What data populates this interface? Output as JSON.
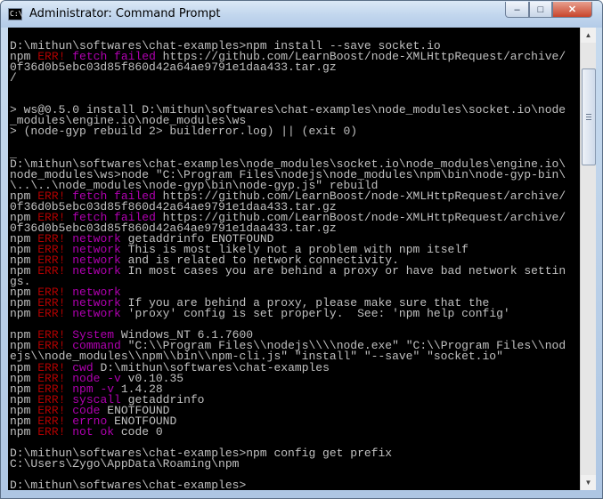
{
  "window": {
    "title": "Administrator: Command Prompt",
    "icon_text": "C:\\",
    "icon": "console-icon"
  },
  "controls": {
    "minimize_icon": "minimize-icon",
    "maximize_icon": "maximize-icon",
    "close_icon": "close-icon",
    "minimize_glyph": "–",
    "maximize_glyph": "□",
    "close_glyph": "✕"
  },
  "scrollbar": {
    "up_glyph": "▲",
    "down_glyph": "▼",
    "thumb_fraction_top": 0.06,
    "thumb_fraction_size": 0.22
  },
  "colors": {
    "console_bg": "#000000",
    "console_text": "#c0c0c0",
    "err_red": "#b00000",
    "err_magenta": "#b000b0"
  },
  "console_lines": [
    [
      {
        "t": "D:\\mithun\\softwares\\chat-examples>npm install --save socket.io",
        "c": "gray"
      }
    ],
    [
      {
        "t": "npm ",
        "c": "gray"
      },
      {
        "t": "ERR!",
        "c": "red"
      },
      {
        "t": " ",
        "c": "gray"
      },
      {
        "t": "fetch failed",
        "c": "mag"
      },
      {
        "t": " https://github.com/LearnBoost/node-XMLHttpRequest/archive/",
        "c": "gray"
      }
    ],
    [
      {
        "t": "0f36d0b5ebc03d85f860d42a64ae9791e1daa433.tar.gz",
        "c": "gray"
      }
    ],
    [
      {
        "t": "/",
        "c": "gray"
      }
    ],
    [
      {
        "t": "",
        "c": "gray"
      }
    ],
    [
      {
        "t": "",
        "c": "gray"
      }
    ],
    [
      {
        "t": "> ws@0.5.0 install D:\\mithun\\softwares\\chat-examples\\node_modules\\socket.io\\node",
        "c": "gray"
      }
    ],
    [
      {
        "t": "_modules\\engine.io\\node_modules\\ws",
        "c": "gray"
      }
    ],
    [
      {
        "t": "> (node-gyp rebuild 2> builderror.log) || (exit 0)",
        "c": "gray"
      }
    ],
    [
      {
        "t": "",
        "c": "gray"
      }
    ],
    [
      {
        "t": "_",
        "c": "gray"
      }
    ],
    [
      {
        "t": "D:\\mithun\\softwares\\chat-examples\\node_modules\\socket.io\\node_modules\\engine.io\\",
        "c": "gray"
      }
    ],
    [
      {
        "t": "node_modules\\ws>node \"C:\\Program Files\\nodejs\\node_modules\\npm\\bin\\node-gyp-bin\\",
        "c": "gray"
      }
    ],
    [
      {
        "t": "\\..\\..\\node_modules\\node-gyp\\bin\\node-gyp.js\" rebuild",
        "c": "gray"
      }
    ],
    [
      {
        "t": "npm ",
        "c": "gray"
      },
      {
        "t": "ERR!",
        "c": "red"
      },
      {
        "t": " ",
        "c": "gray"
      },
      {
        "t": "fetch failed",
        "c": "mag"
      },
      {
        "t": " https://github.com/LearnBoost/node-XMLHttpRequest/archive/",
        "c": "gray"
      }
    ],
    [
      {
        "t": "0f36d0b5ebc03d85f860d42a64ae9791e1daa433.tar.gz",
        "c": "gray"
      }
    ],
    [
      {
        "t": "npm ",
        "c": "gray"
      },
      {
        "t": "ERR!",
        "c": "red"
      },
      {
        "t": " ",
        "c": "gray"
      },
      {
        "t": "fetch failed",
        "c": "mag"
      },
      {
        "t": " https://github.com/LearnBoost/node-XMLHttpRequest/archive/",
        "c": "gray"
      }
    ],
    [
      {
        "t": "0f36d0b5ebc03d85f860d42a64ae9791e1daa433.tar.gz",
        "c": "gray"
      }
    ],
    [
      {
        "t": "npm ",
        "c": "gray"
      },
      {
        "t": "ERR!",
        "c": "red"
      },
      {
        "t": " ",
        "c": "gray"
      },
      {
        "t": "network",
        "c": "mag"
      },
      {
        "t": " getaddrinfo ENOTFOUND",
        "c": "gray"
      }
    ],
    [
      {
        "t": "npm ",
        "c": "gray"
      },
      {
        "t": "ERR!",
        "c": "red"
      },
      {
        "t": " ",
        "c": "gray"
      },
      {
        "t": "network",
        "c": "mag"
      },
      {
        "t": " This is most likely not a problem with npm itself",
        "c": "gray"
      }
    ],
    [
      {
        "t": "npm ",
        "c": "gray"
      },
      {
        "t": "ERR!",
        "c": "red"
      },
      {
        "t": " ",
        "c": "gray"
      },
      {
        "t": "network",
        "c": "mag"
      },
      {
        "t": " and is related to network connectivity.",
        "c": "gray"
      }
    ],
    [
      {
        "t": "npm ",
        "c": "gray"
      },
      {
        "t": "ERR!",
        "c": "red"
      },
      {
        "t": " ",
        "c": "gray"
      },
      {
        "t": "network",
        "c": "mag"
      },
      {
        "t": " In most cases you are behind a proxy or have bad network settin",
        "c": "gray"
      }
    ],
    [
      {
        "t": "gs.",
        "c": "gray"
      }
    ],
    [
      {
        "t": "npm ",
        "c": "gray"
      },
      {
        "t": "ERR!",
        "c": "red"
      },
      {
        "t": " ",
        "c": "gray"
      },
      {
        "t": "network",
        "c": "mag"
      }
    ],
    [
      {
        "t": "npm ",
        "c": "gray"
      },
      {
        "t": "ERR!",
        "c": "red"
      },
      {
        "t": " ",
        "c": "gray"
      },
      {
        "t": "network",
        "c": "mag"
      },
      {
        "t": " If you are behind a proxy, please make sure that the",
        "c": "gray"
      }
    ],
    [
      {
        "t": "npm ",
        "c": "gray"
      },
      {
        "t": "ERR!",
        "c": "red"
      },
      {
        "t": " ",
        "c": "gray"
      },
      {
        "t": "network",
        "c": "mag"
      },
      {
        "t": " 'proxy' config is set properly.  See: 'npm help config'",
        "c": "gray"
      }
    ],
    [
      {
        "t": "",
        "c": "gray"
      }
    ],
    [
      {
        "t": "npm ",
        "c": "gray"
      },
      {
        "t": "ERR!",
        "c": "red"
      },
      {
        "t": " ",
        "c": "gray"
      },
      {
        "t": "System",
        "c": "mag"
      },
      {
        "t": " Windows_NT 6.1.7600",
        "c": "gray"
      }
    ],
    [
      {
        "t": "npm ",
        "c": "gray"
      },
      {
        "t": "ERR!",
        "c": "red"
      },
      {
        "t": " ",
        "c": "gray"
      },
      {
        "t": "command",
        "c": "mag"
      },
      {
        "t": " \"C:\\\\Program Files\\\\nodejs\\\\\\\\node.exe\" \"C:\\\\Program Files\\\\nod",
        "c": "gray"
      }
    ],
    [
      {
        "t": "ejs\\\\node_modules\\\\npm\\\\bin\\\\npm-cli.js\" \"install\" \"--save\" \"socket.io\"",
        "c": "gray"
      }
    ],
    [
      {
        "t": "npm ",
        "c": "gray"
      },
      {
        "t": "ERR!",
        "c": "red"
      },
      {
        "t": " ",
        "c": "gray"
      },
      {
        "t": "cwd",
        "c": "mag"
      },
      {
        "t": " D:\\mithun\\softwares\\chat-examples",
        "c": "gray"
      }
    ],
    [
      {
        "t": "npm ",
        "c": "gray"
      },
      {
        "t": "ERR!",
        "c": "red"
      },
      {
        "t": " ",
        "c": "gray"
      },
      {
        "t": "node -v",
        "c": "mag"
      },
      {
        "t": " v0.10.35",
        "c": "gray"
      }
    ],
    [
      {
        "t": "npm ",
        "c": "gray"
      },
      {
        "t": "ERR!",
        "c": "red"
      },
      {
        "t": " ",
        "c": "gray"
      },
      {
        "t": "npm -v",
        "c": "mag"
      },
      {
        "t": " 1.4.28",
        "c": "gray"
      }
    ],
    [
      {
        "t": "npm ",
        "c": "gray"
      },
      {
        "t": "ERR!",
        "c": "red"
      },
      {
        "t": " ",
        "c": "gray"
      },
      {
        "t": "syscall",
        "c": "mag"
      },
      {
        "t": " getaddrinfo",
        "c": "gray"
      }
    ],
    [
      {
        "t": "npm ",
        "c": "gray"
      },
      {
        "t": "ERR!",
        "c": "red"
      },
      {
        "t": " ",
        "c": "gray"
      },
      {
        "t": "code",
        "c": "mag"
      },
      {
        "t": " ENOTFOUND",
        "c": "gray"
      }
    ],
    [
      {
        "t": "npm ",
        "c": "gray"
      },
      {
        "t": "ERR!",
        "c": "red"
      },
      {
        "t": " ",
        "c": "gray"
      },
      {
        "t": "errno",
        "c": "mag"
      },
      {
        "t": " ENOTFOUND",
        "c": "gray"
      }
    ],
    [
      {
        "t": "npm ",
        "c": "gray"
      },
      {
        "t": "ERR!",
        "c": "red"
      },
      {
        "t": " ",
        "c": "gray"
      },
      {
        "t": "not ok",
        "c": "mag"
      },
      {
        "t": " code 0",
        "c": "gray"
      }
    ],
    [
      {
        "t": "",
        "c": "gray"
      }
    ],
    [
      {
        "t": "D:\\mithun\\softwares\\chat-examples>npm config get prefix",
        "c": "gray"
      }
    ],
    [
      {
        "t": "C:\\Users\\Zygo\\AppData\\Roaming\\npm",
        "c": "gray"
      }
    ],
    [
      {
        "t": "",
        "c": "gray"
      }
    ],
    [
      {
        "t": "D:\\mithun\\softwares\\chat-examples>",
        "c": "gray"
      }
    ]
  ]
}
